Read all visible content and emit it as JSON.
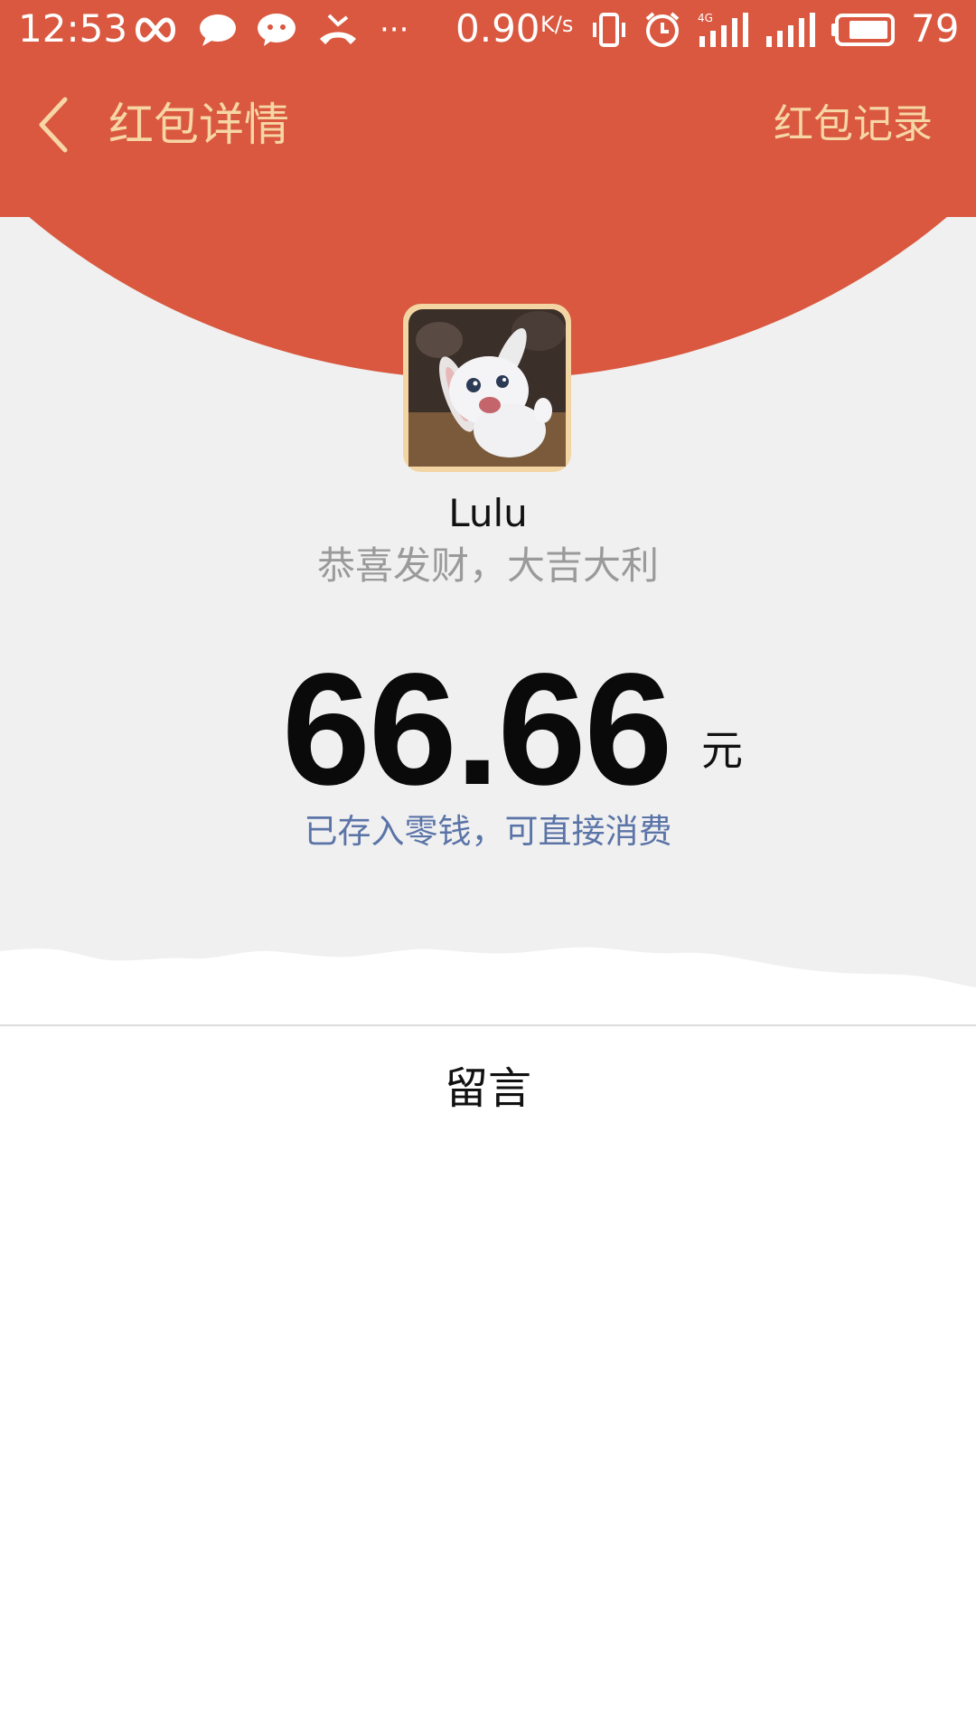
{
  "status_bar": {
    "time": "12:53",
    "network_speed": "0.90",
    "network_speed_unit": "K/s",
    "network_type": "4G",
    "battery_level": "79",
    "more_label": "···"
  },
  "nav": {
    "title": "红包详情",
    "record_label": "红包记录"
  },
  "red_packet": {
    "sender_name": "Lulu",
    "greeting": "恭喜发财，大吉大利",
    "amount": "66.66",
    "unit": "元",
    "deposit_note": "已存入零钱，可直接消费"
  },
  "message_section": {
    "label": "留言"
  },
  "colors": {
    "header_red": "#d9583f",
    "header_text": "#f7d6a6",
    "link_blue": "#5b74a8",
    "page_gray": "#f0f0f0"
  }
}
